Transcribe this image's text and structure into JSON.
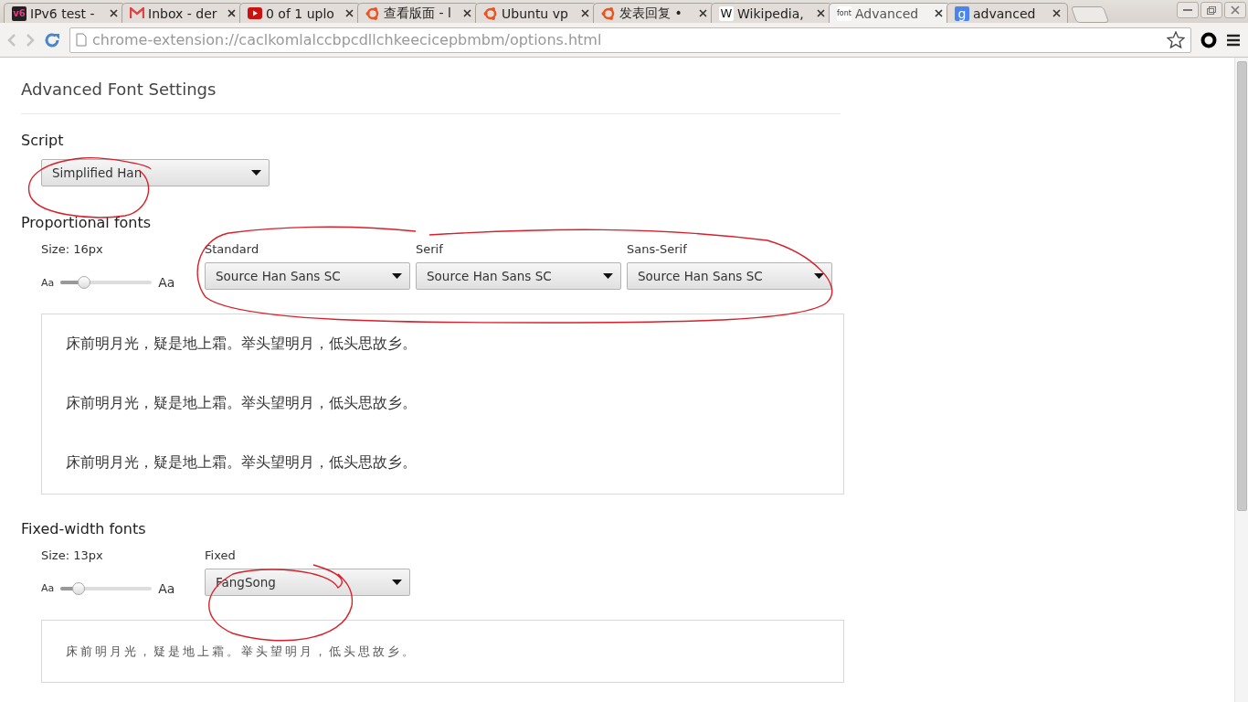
{
  "tabs": [
    {
      "title": "IPv6 test -",
      "kind": "v6",
      "favicon_text": "v6",
      "selected": false
    },
    {
      "title": "Inbox - der",
      "kind": "mail",
      "selected": false
    },
    {
      "title": "0 of 1 uplo",
      "kind": "play",
      "selected": false
    },
    {
      "title": "查看版面 - l",
      "kind": "ubuntu",
      "selected": false
    },
    {
      "title": "Ubuntu vp",
      "kind": "ubuntu",
      "selected": false
    },
    {
      "title": "发表回复 •",
      "kind": "ubuntu",
      "selected": false
    },
    {
      "title": "Wikipedia,",
      "kind": "wiki",
      "favicon_text": "W",
      "selected": false
    },
    {
      "title": "Advanced",
      "kind": "font",
      "favicon_text": "font",
      "selected": true
    },
    {
      "title": "advanced",
      "kind": "google",
      "favicon_text": "g",
      "selected": false
    }
  ],
  "address_bar": {
    "url": "chrome-extension://caclkomlalccbpcdllchkeecicepbmbm/options.html"
  },
  "page": {
    "title": "Advanced Font Settings",
    "script": {
      "label": "Script",
      "value": "Simplified Han"
    },
    "sections": [
      {
        "heading": "Proportional fonts",
        "size_label": "Size: 16px",
        "small_label": "Aa",
        "large_label": "Aa",
        "level": 0.26,
        "fonts": [
          {
            "label": "Standard",
            "value": "Source Han Sans SC"
          },
          {
            "label": "Serif",
            "value": "Source Han Sans SC"
          },
          {
            "label": "Sans-Serif",
            "value": "Source Han Sans SC"
          }
        ],
        "samples": [
          "床前明月光，疑是地上霜。举头望明月，低头思故乡。",
          "床前明月光，疑是地上霜。举头望明月，低头思故乡。",
          "床前明月光，疑是地上霜。举头望明月，低头思故乡。"
        ]
      },
      {
        "heading": "Fixed-width fonts",
        "size_label": "Size: 13px",
        "small_label": "Aa",
        "large_label": "Aa",
        "level": 0.2,
        "fonts": [
          {
            "label": "Fixed",
            "value": "FangSong"
          }
        ],
        "samples": [
          "床前明月光，疑是地上霜。举头望明月，低头思故乡。"
        ]
      }
    ]
  }
}
